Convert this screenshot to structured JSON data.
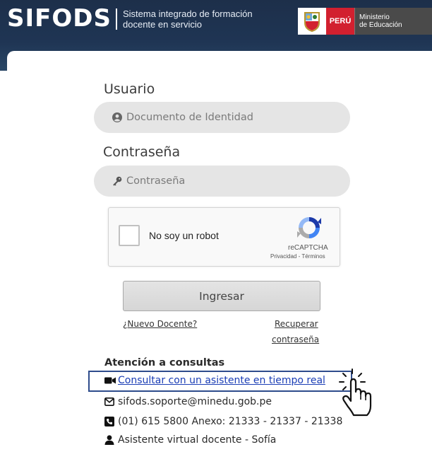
{
  "header": {
    "logo": "SIFODS",
    "tagline_line1": "Sistema integrado de formación",
    "tagline_line2": "docente en servicio",
    "country": "PERÚ",
    "ministry_line1": "Ministerio",
    "ministry_line2": "de Educación"
  },
  "login": {
    "user_label": "Usuario",
    "user_placeholder": "Documento de Identidad",
    "password_label": "Contraseña",
    "password_placeholder": "Contraseña",
    "submit_label": "Ingresar",
    "new_teacher_link": "¿Nuevo Docente?",
    "recover_line1": "Recuperar",
    "recover_line2": "contraseña"
  },
  "captcha": {
    "label": "No soy un robot",
    "brand": "reCAPTCHA",
    "terms": "Privacidad - Términos"
  },
  "support": {
    "title": "Atención a consultas",
    "realtime_link": "Consultar con un asistente en tiempo real",
    "email": "sifods.soporte@minedu.gob.pe",
    "phone": "(01) 615 5800 Anexo: 21333 - 21337 - 21338",
    "virtual_assistant": "Asistente virtual docente - Sofía"
  },
  "icons": {
    "user": "user-circle-icon",
    "password": "key-icon",
    "video": "video-camera-icon",
    "email": "envelope-icon",
    "phone": "phone-icon",
    "assistant": "user-icon",
    "pointer": "hand-pointer-icon"
  },
  "colors": {
    "header_bg": "#1f3554",
    "peru_red": "#d2202f",
    "field_bg": "#e5e5e5",
    "link_blue": "#1a3db5",
    "highlight_border": "#2e4c8c"
  }
}
